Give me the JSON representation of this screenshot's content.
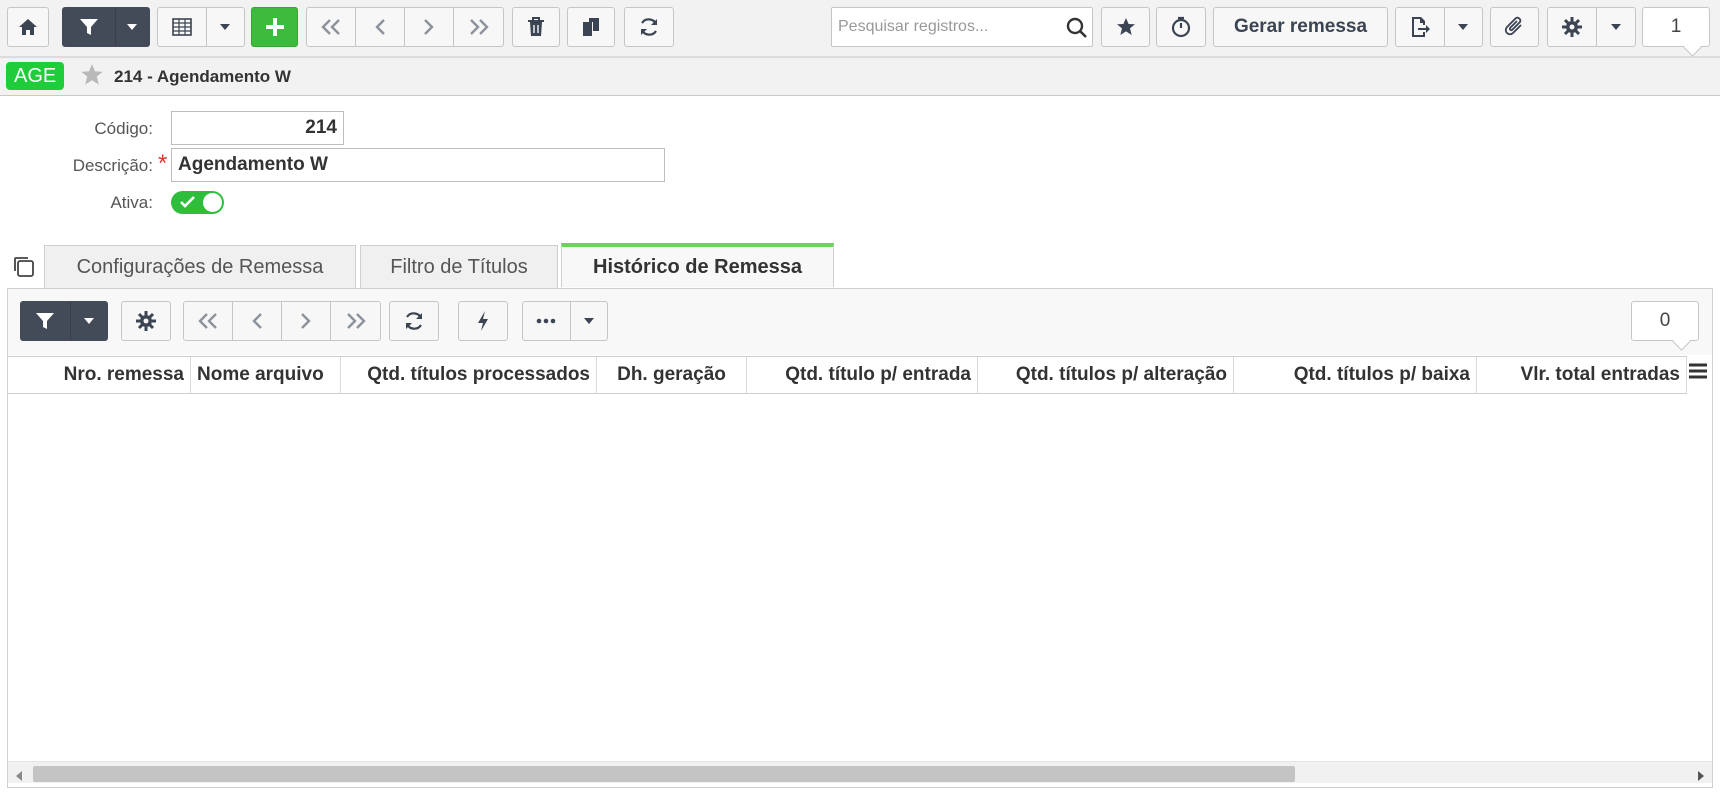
{
  "toolbar": {
    "search_placeholder": "Pesquisar registros...",
    "gerar_label": "Gerar remessa",
    "record_count": "1"
  },
  "header": {
    "badge": "AGE",
    "title": "214 - Agendamento W"
  },
  "form": {
    "codigo_label": "Código:",
    "codigo_value": "214",
    "descricao_label": "Descrição:",
    "descricao_value": "Agendamento W",
    "ativa_label": "Ativa:",
    "ativa_on": true
  },
  "tabs": [
    {
      "label": "Configurações de Remessa",
      "active": false
    },
    {
      "label": "Filtro de Títulos",
      "active": false
    },
    {
      "label": "Histórico de Remessa",
      "active": true
    }
  ],
  "grid": {
    "count": "0",
    "columns": [
      "Nro. remessa",
      "Nome arquivo",
      "Qtd. títulos processados",
      "Dh. geração",
      "Qtd. título p/ entrada",
      "Qtd. títulos p/ alteração",
      "Qtd. títulos p/ baixa",
      "Vlr. total entradas"
    ],
    "rows": []
  },
  "colors": {
    "accent_green": "#3dbb3d",
    "badge_green": "#1fcc3a",
    "dark_button": "#434b58",
    "active_tab_border": "#6fd05f"
  }
}
